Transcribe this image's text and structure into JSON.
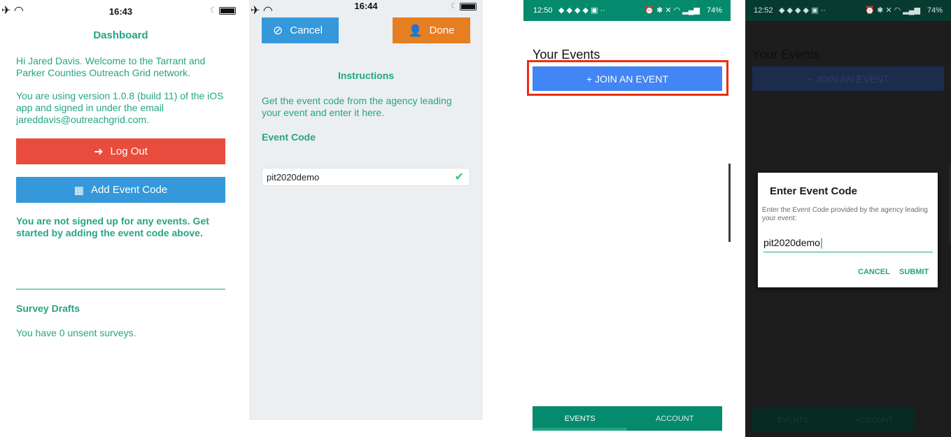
{
  "panel1": {
    "status": {
      "time": "16:43"
    },
    "title": "Dashboard",
    "welcome": "Hi Jared Davis. Welcome to the Tarrant and Parker Counties Outreach Grid network.",
    "version": "You are using version 1.0.8 (build 11) of the iOS app and signed in under the email jareddavis@outreachgrid.com.",
    "logout_label": "Log Out",
    "add_event_label": "Add Event Code",
    "no_events": "You are not signed up for any events. Get started by adding the event code above.",
    "drafts_title": "Survey Drafts",
    "drafts_text": "You have 0 unsent surveys.",
    "colors": {
      "logout": "#e84c3d",
      "add": "#3498db",
      "accent": "#24a584"
    }
  },
  "panel2": {
    "status": {
      "time": "16:44"
    },
    "cancel_label": "Cancel",
    "done_label": "Done",
    "instructions_title": "Instructions",
    "instructions_text": "Get the event code from the agency leading your event and enter it here.",
    "event_code_label": "Event Code",
    "event_code_value": "pit2020demo",
    "colors": {
      "cancel": "#3498db",
      "done": "#e67e22"
    }
  },
  "panel3": {
    "status": {
      "time": "12:50",
      "right": "74%"
    },
    "title": "Your Events",
    "join_label": "+ JOIN AN EVENT",
    "tab_events": "EVENTS",
    "tab_account": "ACCOUNT",
    "colors": {
      "join": "#4285f4",
      "highlight": "#ea2e10",
      "tabbar": "#058a6d"
    }
  },
  "panel4": {
    "status": {
      "time": "12:52",
      "right": "74%"
    },
    "title": "Your Events",
    "join_label": "+ JOIN AN EVENT",
    "tab_events": "EVENTS",
    "tab_account": "ACCOUNT",
    "dialog": {
      "title": "Enter Event Code",
      "message": "Enter the Event Code provided by the agency leading your event:",
      "input_value": "pit2020demo",
      "cancel_label": "CANCEL",
      "submit_label": "SUBMIT"
    }
  }
}
